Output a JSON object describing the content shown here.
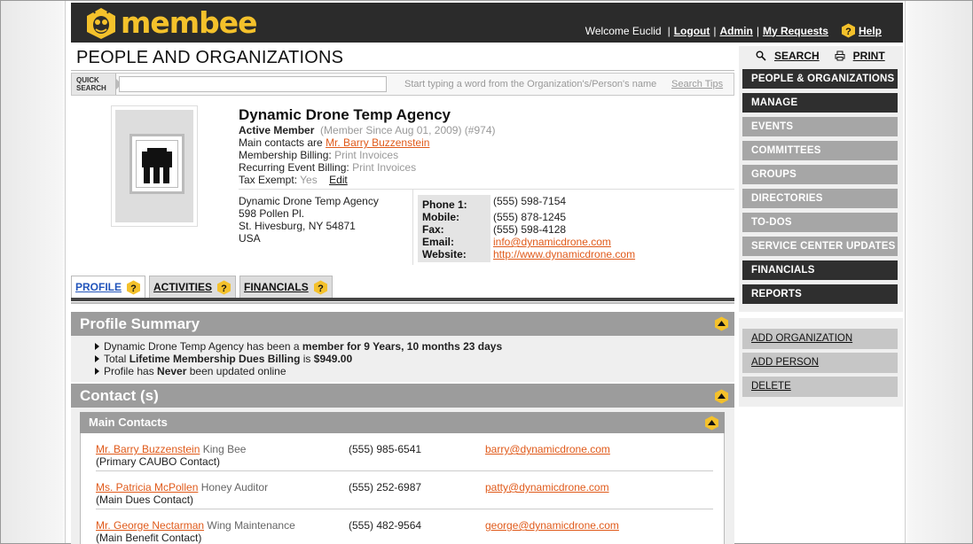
{
  "app": {
    "logo_text": "membee",
    "accent": "#f4c12b"
  },
  "topnav": {
    "welcome": "Welcome Euclid",
    "logout": "Logout",
    "admin": "Admin",
    "my_requests": "My Requests",
    "help": "Help"
  },
  "page_title": "PEOPLE AND ORGANIZATIONS",
  "quick_search": {
    "tag_line1": "QUICK",
    "tag_line2": "SEARCH",
    "value": "",
    "hint": "Start typing a word from the Organization's/Person's name",
    "tips": "Search Tips"
  },
  "org": {
    "name": "Dynamic Drone Temp Agency",
    "status": "Active Member",
    "member_since": "(Member Since Aug 01, 2009) (#974)",
    "main_contacts_label": "Main contacts are",
    "main_contacts_value": "Mr. Barry Buzzenstein",
    "membership_billing_label": "Membership Billing:",
    "membership_billing_value": "Print Invoices",
    "recurring_billing_label": "Recurring Event Billing:",
    "recurring_billing_value": "Print Invoices",
    "tax_exempt_label": "Tax Exempt:",
    "tax_exempt_value": "Yes",
    "edit": "Edit",
    "address": [
      "Dynamic Drone Temp Agency",
      "598 Pollen Pl.",
      "St. Hivesburg, NY 54871",
      "USA"
    ],
    "contact_labels": [
      "Phone 1:",
      "Mobile:",
      "Fax:",
      "Email:",
      "Website:"
    ],
    "contact_values": {
      "phone1": "(555) 598-7154",
      "mobile": "(555) 878-1245",
      "fax": "(555) 598-4128",
      "email": "info@dynamicdrone.com",
      "website": "http://www.dynamicdrone.com"
    }
  },
  "tabs": [
    {
      "label": "PROFILE",
      "active": true
    },
    {
      "label": "ACTIVITIES",
      "active": false
    },
    {
      "label": "FINANCIALS",
      "active": false
    }
  ],
  "profile_summary": {
    "title": "Profile Summary",
    "line1_pre": "Dynamic Drone Temp Agency has been a",
    "line1_bold": "member for 9 Years, 10 months 23 days",
    "line2_pre": "Total",
    "line2_bold": "Lifetime Membership Dues Billing",
    "line2_mid": "is",
    "line2_amount": "$949.00",
    "line3_pre": "Profile has",
    "line3_bold": "Never",
    "line3_post": "been updated online"
  },
  "contacts": {
    "title": "Contact (s)",
    "main_title": "Main Contacts",
    "rows": [
      {
        "name": "Mr. Barry Buzzenstein",
        "role": "King Bee",
        "type": "(Primary CAUBO Contact)",
        "phone": "(555) 985-6541",
        "email": "barry@dynamicdrone.com"
      },
      {
        "name": "Ms. Patricia McPollen",
        "role": "Honey Auditor",
        "type": "(Main Dues Contact)",
        "phone": "(555) 252-6987",
        "email": "patty@dynamicdrone.com"
      },
      {
        "name": "Mr. George Nectarman",
        "role": "Wing Maintenance",
        "type": "(Main Benefit Contact)",
        "phone": "(555) 482-9564",
        "email": "george@dynamicdrone.com"
      }
    ]
  },
  "sidebar": {
    "search": "SEARCH",
    "print": "PRINT",
    "nav": [
      {
        "label": "PEOPLE & ORGANIZATIONS",
        "dark": true
      },
      {
        "label": "MANAGE",
        "dark": true
      },
      {
        "label": "EVENTS",
        "dark": false
      },
      {
        "label": "COMMITTEES",
        "dark": false
      },
      {
        "label": "GROUPS",
        "dark": false
      },
      {
        "label": "DIRECTORIES",
        "dark": false
      },
      {
        "label": "TO-DOS",
        "dark": false
      },
      {
        "label": "SERVICE CENTER UPDATES",
        "dark": false
      },
      {
        "label": "FINANCIALS",
        "dark": true
      },
      {
        "label": "REPORTS",
        "dark": true
      }
    ],
    "actions": [
      "ADD ORGANIZATION",
      "ADD PERSON",
      "DELETE"
    ]
  }
}
